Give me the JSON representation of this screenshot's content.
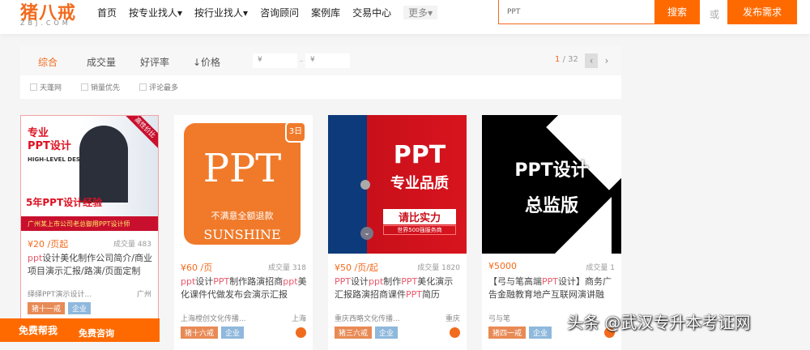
{
  "header": {
    "logo": "猪八戒",
    "logo_sub": "ZBJ.COM",
    "nav": [
      "首页",
      "按专业找人▾",
      "按行业找人▾",
      "咨询顾问",
      "案例库",
      "交易中心"
    ],
    "more": "更多▾",
    "search_value": "PPT",
    "search_button": "搜索",
    "or": "或",
    "publish_button": "发布需求"
  },
  "filter": {
    "sorts": [
      "综合",
      "成交量",
      "好评率",
      "↓价格"
    ],
    "price_from": "¥",
    "price_to": "¥",
    "dash": "-",
    "page_current": "1",
    "page_total": "/ 32",
    "prev": "‹",
    "next": "›",
    "checks": [
      "天蓬网",
      "销量优先",
      "评论最多"
    ]
  },
  "cards": [
    {
      "img_text": [
        "专业",
        "PPT设计",
        "HIGH-LEVEL DESGIN",
        "5年PPT设计经验",
        "广州某上市公司老总御用PPT设计师",
        "高性价比"
      ],
      "price": "¥20 /页起",
      "sold": "成交量 483",
      "title_parts": [
        [
          "ppt",
          1
        ],
        [
          "设计美化制作公司简介/商业项目演示汇报/路演/页面定制",
          0
        ]
      ],
      "shop": "绎绎PPT演示设计...",
      "city": "广州",
      "tag1": "猪十一戒",
      "tag2": "企业"
    },
    {
      "img_text": [
        "PPT",
        "不满意全额退款",
        "SUNSHINE",
        "3日"
      ],
      "price": "¥60 /页",
      "sold": "成交量 318",
      "title_parts": [
        [
          "ppt",
          1
        ],
        [
          "设计",
          0
        ],
        [
          "PPT",
          1
        ],
        [
          "制作路演招商",
          0
        ],
        [
          "ppt",
          1
        ],
        [
          "美化课件代做发布会演示汇报",
          0
        ]
      ],
      "shop": "上海樘创文化传播...",
      "city": "上海",
      "tag1": "猪十六戒",
      "tag2": "企业"
    },
    {
      "img_text": [
        "PPT",
        "专业品质",
        "请比实力",
        "世界500强服务商"
      ],
      "price": "¥50 /页/起",
      "sold": "成交量 1820",
      "title_parts": [
        [
          "PPT",
          1
        ],
        [
          "设计",
          0
        ],
        [
          "ppt",
          1
        ],
        [
          "制作",
          0
        ],
        [
          "PPT",
          1
        ],
        [
          "美化演示汇报路演招商课件",
          0
        ],
        [
          "PPT",
          1
        ],
        [
          "简历",
          0
        ]
      ],
      "shop": "重庆西略文化传播...",
      "city": "重庆",
      "tag1": "猪三六戒",
      "tag2": "企业"
    },
    {
      "img_text": [
        "PPT设计",
        "总监版"
      ],
      "price": "¥5000",
      "sold": "成交量 1",
      "title_parts": [
        [
          "【弓与笔高端",
          0
        ],
        [
          "PPT",
          1
        ],
        [
          "设计】商务广告金融教育地产互联网演讲融",
          0
        ]
      ],
      "shop": "弓与笔",
      "city": "",
      "tag1": "猪四一戒",
      "tag2": "企业"
    }
  ],
  "banner": {
    "left": "免费帮我",
    "right": "免费咨询"
  },
  "watermark": "头条 @武汉专升本考证网"
}
